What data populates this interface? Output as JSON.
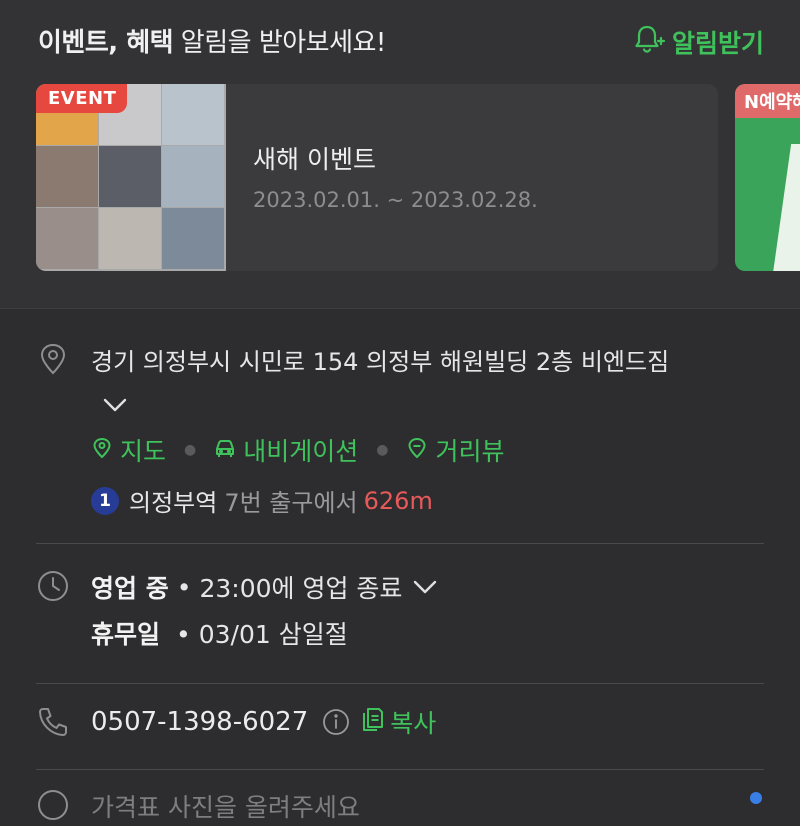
{
  "header": {
    "title_bold": "이벤트, 혜택",
    "title_rest": " 알림을 받아보세요!",
    "notify_label": "알림받기"
  },
  "event_card": {
    "badge": "EVENT",
    "title": "새해 이벤트",
    "date_range": "2023.02.01. ~ 2023.02.28."
  },
  "next_card": {
    "badge": "N예약혜"
  },
  "address": {
    "text": "경기 의정부시 시민로 154 의정부 해원빌딩 2층 비엔드짐",
    "links": [
      "지도",
      "내비게이션",
      "거리뷰"
    ]
  },
  "subway": {
    "line": "1",
    "station": "의정부역",
    "exit": "7번 출구에서",
    "distance": "626m"
  },
  "hours": {
    "status": "영업 중",
    "detail": "23:00에 영업 종료",
    "holiday_label": "휴무일",
    "holiday_detail": "03/01 삼일절"
  },
  "phone": {
    "number": "0507-1398-6027",
    "copy_label": "복사"
  },
  "cutoff_text": "가격표 사진을 올려주세요",
  "colors": {
    "accent_green": "#3fc25b",
    "event_red": "#e6483f",
    "distance_red": "#e8595a",
    "line1_blue": "#263c96"
  }
}
